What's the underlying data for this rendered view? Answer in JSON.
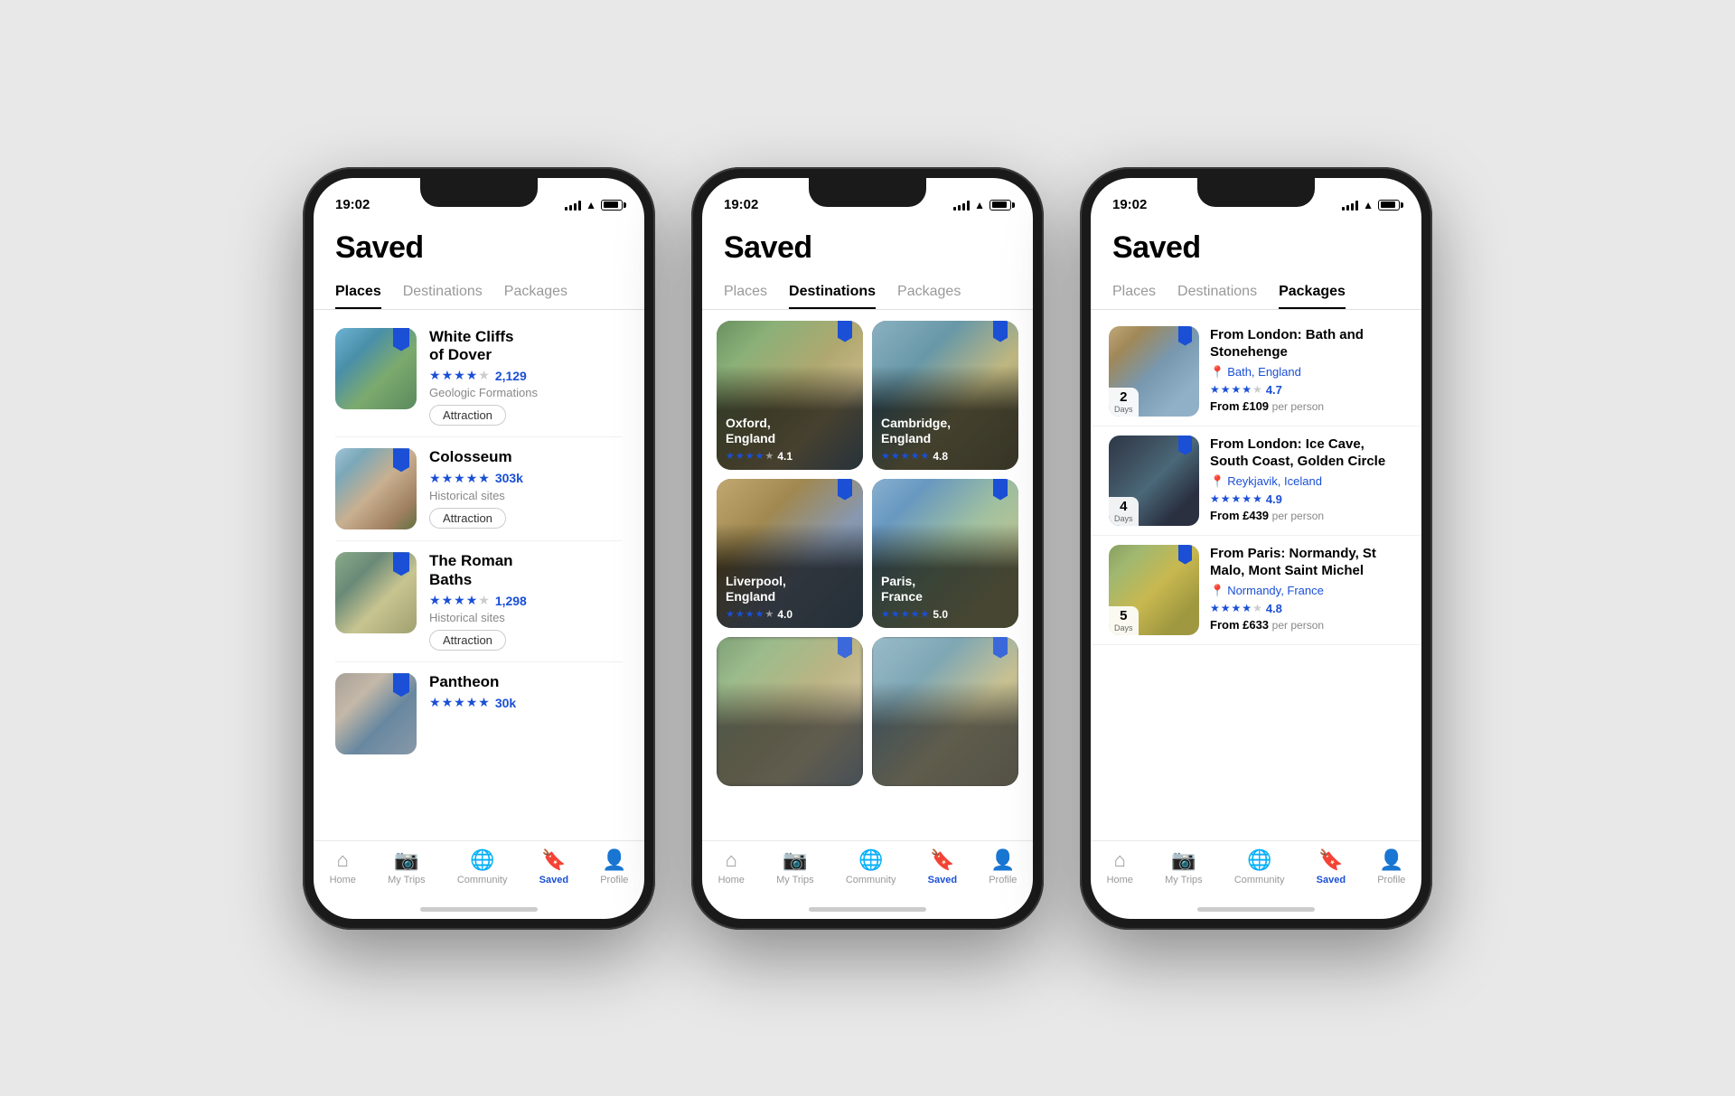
{
  "phones": [
    {
      "id": "places",
      "statusTime": "19:02",
      "pageTitle": "Saved",
      "tabs": [
        {
          "label": "Places",
          "active": true
        },
        {
          "label": "Destinations",
          "active": false
        },
        {
          "label": "Packages",
          "active": false
        }
      ],
      "places": [
        {
          "name": "White Cliffs\nof Dover",
          "rating": 4,
          "reviewCount": "2,129",
          "category": "Geologic Formations",
          "badge": "Attraction",
          "imgClass": "img-white-cliffs"
        },
        {
          "name": "Colosseum",
          "rating": 5,
          "reviewCount": "303k",
          "category": "Historical sites",
          "badge": "Attraction",
          "imgClass": "img-colosseum"
        },
        {
          "name": "The Roman\nBaths",
          "rating": 3.5,
          "reviewCount": "1,298",
          "category": "Historical sites",
          "badge": "Attraction",
          "imgClass": "img-roman-baths"
        },
        {
          "name": "Pantheon",
          "rating": 5,
          "reviewCount": "30k",
          "category": "",
          "badge": "",
          "imgClass": "img-pantheon"
        }
      ],
      "bottomNav": [
        {
          "icon": "home",
          "label": "Home",
          "active": false
        },
        {
          "icon": "camera",
          "label": "My Trips",
          "active": false
        },
        {
          "icon": "globe",
          "label": "Community",
          "active": false
        },
        {
          "icon": "bookmark",
          "label": "Saved",
          "active": true
        },
        {
          "icon": "user",
          "label": "Profile",
          "active": false
        }
      ]
    },
    {
      "id": "destinations",
      "statusTime": "19:02",
      "pageTitle": "Saved",
      "tabs": [
        {
          "label": "Places",
          "active": false
        },
        {
          "label": "Destinations",
          "active": true
        },
        {
          "label": "Packages",
          "active": false
        }
      ],
      "destinations": [
        {
          "name": "Oxford,\nEngland",
          "rating": 4.1,
          "stars": 4,
          "imgClass": "img-oxford"
        },
        {
          "name": "Cambridge,\nEngland",
          "rating": 4.8,
          "stars": 5,
          "imgClass": "img-cambridge"
        },
        {
          "name": "Liverpool,\nEngland",
          "rating": 4.0,
          "stars": 4,
          "imgClass": "img-liverpool"
        },
        {
          "name": "Paris,\nFrance",
          "rating": 5.0,
          "stars": 5,
          "imgClass": "img-paris"
        },
        {
          "name": "...",
          "rating": 0,
          "stars": 0,
          "imgClass": "img-oxford"
        },
        {
          "name": "...",
          "rating": 0,
          "stars": 0,
          "imgClass": "img-cambridge"
        }
      ],
      "bottomNav": [
        {
          "icon": "home",
          "label": "Home",
          "active": false
        },
        {
          "icon": "camera",
          "label": "My Trips",
          "active": false
        },
        {
          "icon": "globe",
          "label": "Community",
          "active": false
        },
        {
          "icon": "bookmark",
          "label": "Saved",
          "active": true
        },
        {
          "icon": "user",
          "label": "Profile",
          "active": false
        }
      ]
    },
    {
      "id": "packages",
      "statusTime": "19:02",
      "pageTitle": "Saved",
      "tabs": [
        {
          "label": "Places",
          "active": false
        },
        {
          "label": "Destinations",
          "active": false
        },
        {
          "label": "Packages",
          "active": true
        }
      ],
      "packages": [
        {
          "title": "From London: Bath and Stonehenge",
          "location": "Bath, England",
          "days": 2,
          "rating": 4,
          "score": 4.7,
          "price": "£109",
          "imgClass": "img-bath"
        },
        {
          "title": "From London: Ice Cave, South Coast, Golden Circle",
          "location": "Reykjavik, Iceland",
          "days": 4,
          "rating": 5,
          "score": 4.9,
          "price": "£439",
          "imgClass": "img-iceland"
        },
        {
          "title": "From Paris: Normandy, St Malo, Mont Saint Michel",
          "location": "Normandy, France",
          "days": 5,
          "rating": 4,
          "score": 4.8,
          "price": "£633",
          "imgClass": "img-normandy"
        }
      ],
      "bottomNav": [
        {
          "icon": "home",
          "label": "Home",
          "active": false
        },
        {
          "icon": "camera",
          "label": "My Trips",
          "active": false
        },
        {
          "icon": "globe",
          "label": "Community",
          "active": false
        },
        {
          "icon": "bookmark",
          "label": "Saved",
          "active": true
        },
        {
          "icon": "user",
          "label": "Profile",
          "active": false
        }
      ]
    }
  ]
}
